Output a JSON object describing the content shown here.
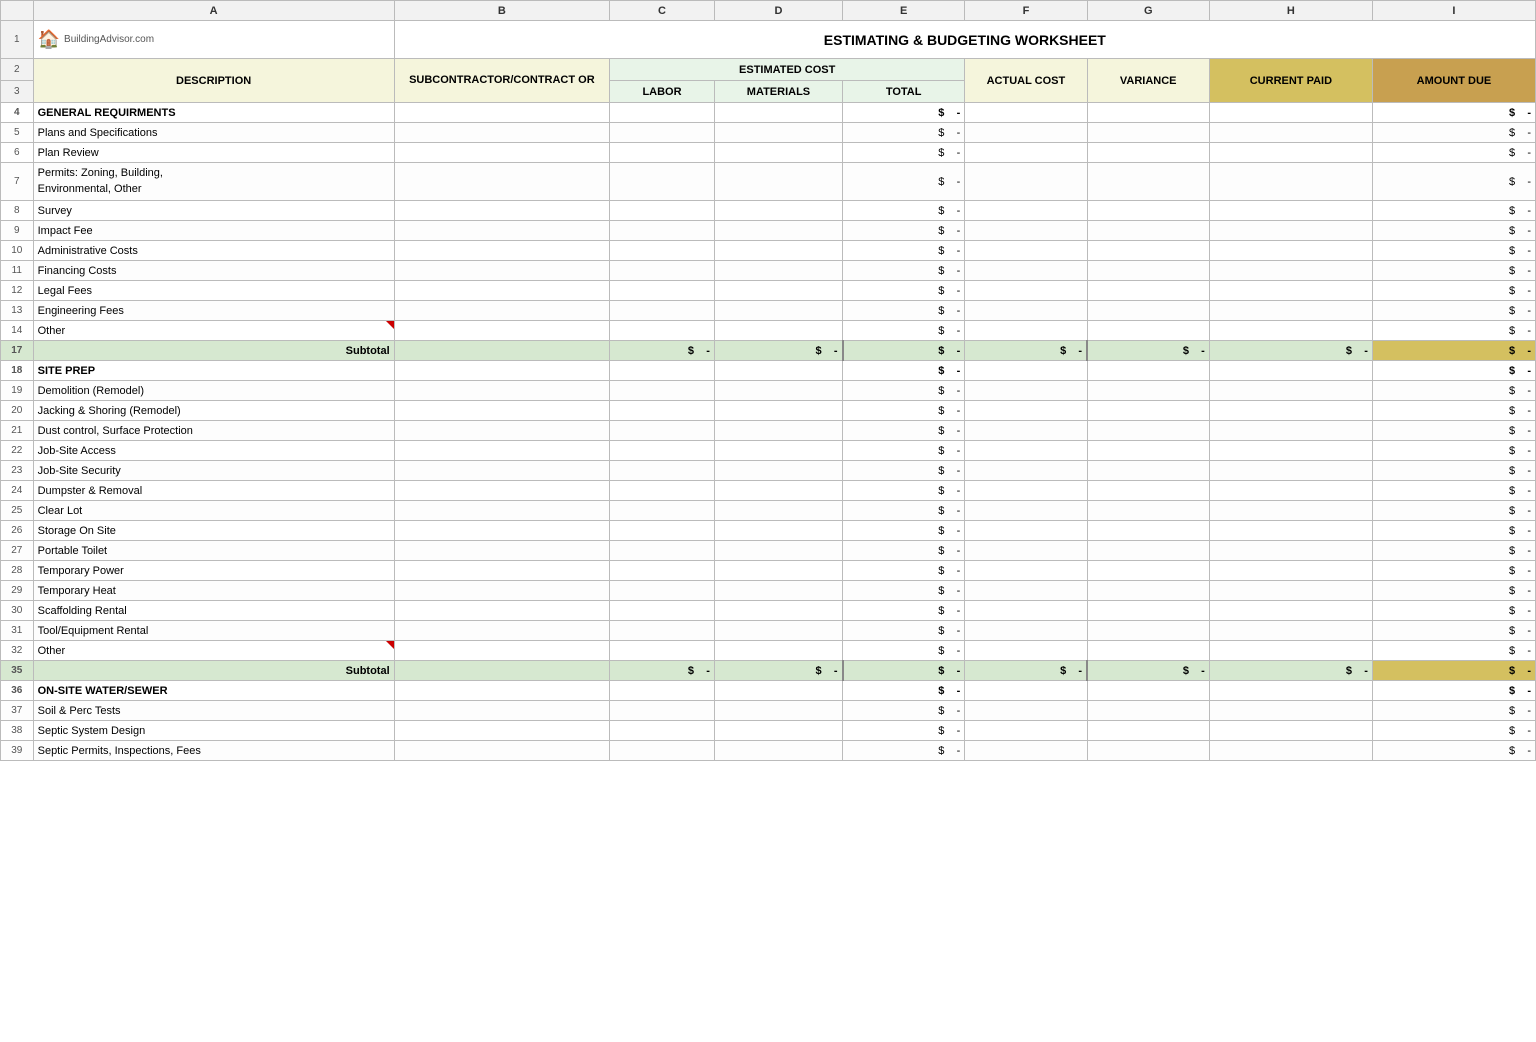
{
  "spreadsheet": {
    "title": "ESTIMATING & BUDGETING WORKSHEET",
    "logo": {
      "icon": "🏠",
      "text": "BuildingAdvisor.com"
    },
    "col_letters": [
      "",
      "A",
      "B",
      "C",
      "D",
      "E",
      "F",
      "G",
      "H",
      "I"
    ],
    "headers": {
      "description": "DESCRIPTION",
      "subcontractor": "SUBCONTRACTOR/CONTRACT OR",
      "estimated_cost": "ESTIMATED COST",
      "labor": "LABOR",
      "materials": "MATERIALS",
      "total": "TOTAL",
      "actual_cost": "ACTUAL COST",
      "variance": "VARIANCE",
      "current_paid": "CURRENT PAID",
      "amount_due": "AMOUNT DUE"
    },
    "rows": [
      {
        "num": "4",
        "desc": "GENERAL REQUIRMENTS",
        "section": true
      },
      {
        "num": "5",
        "desc": "Plans and Specifications"
      },
      {
        "num": "6",
        "desc": "Plan Review"
      },
      {
        "num": "7",
        "desc": "Permits: Zoning, Building,\nEnvironmental, Other",
        "tall": true
      },
      {
        "num": "8",
        "desc": "Survey"
      },
      {
        "num": "9",
        "desc": "Impact Fee"
      },
      {
        "num": "10",
        "desc": "Administrative Costs"
      },
      {
        "num": "11",
        "desc": "Financing Costs"
      },
      {
        "num": "12",
        "desc": "Legal Fees"
      },
      {
        "num": "13",
        "desc": "Engineering Fees"
      },
      {
        "num": "14",
        "desc": "Other",
        "red_triangle": true
      },
      {
        "num": "17",
        "desc": "Subtotal",
        "subtotal": true
      },
      {
        "num": "18",
        "desc": "SITE PREP",
        "section": true
      },
      {
        "num": "19",
        "desc": "Demolition (Remodel)"
      },
      {
        "num": "20",
        "desc": "Jacking & Shoring (Remodel)"
      },
      {
        "num": "21",
        "desc": "Dust control, Surface Protection"
      },
      {
        "num": "22",
        "desc": "Job-Site Access"
      },
      {
        "num": "23",
        "desc": "Job-Site Security"
      },
      {
        "num": "24",
        "desc": "Dumpster & Removal"
      },
      {
        "num": "25",
        "desc": "Clear Lot"
      },
      {
        "num": "26",
        "desc": "Storage On Site"
      },
      {
        "num": "27",
        "desc": "Portable Toilet"
      },
      {
        "num": "28",
        "desc": "Temporary Power"
      },
      {
        "num": "29",
        "desc": "Temporary Heat"
      },
      {
        "num": "30",
        "desc": "Scaffolding Rental"
      },
      {
        "num": "31",
        "desc": "Tool/Equipment Rental"
      },
      {
        "num": "32",
        "desc": "Other",
        "red_triangle": true
      },
      {
        "num": "35",
        "desc": "Subtotal",
        "subtotal": true
      },
      {
        "num": "36",
        "desc": "ON-SITE WATER/SEWER",
        "section": true
      },
      {
        "num": "37",
        "desc": "Soil & Perc Tests"
      },
      {
        "num": "38",
        "desc": "Septic System Design"
      },
      {
        "num": "39",
        "desc": "Septic Permits, Inspections, Fees"
      }
    ]
  }
}
